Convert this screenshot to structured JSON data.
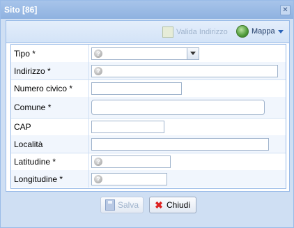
{
  "window": {
    "title": "Sito [86]"
  },
  "toolbar": {
    "valida_label": "Valida Indirizzo",
    "mappa_label": "Mappa"
  },
  "fields": [
    {
      "label": "Tipo *",
      "value": "",
      "kind": "combo"
    },
    {
      "label": "Indirizzo *",
      "value": "",
      "kind": "text-help"
    },
    {
      "label": "Numero civico *",
      "value": "",
      "kind": "text"
    },
    {
      "label": "Comune *",
      "value": "",
      "kind": "text-round"
    },
    {
      "label": "CAP",
      "value": "",
      "kind": "text"
    },
    {
      "label": "Località",
      "value": "",
      "kind": "text"
    },
    {
      "label": "Latitudine *",
      "value": "",
      "kind": "text-help"
    },
    {
      "label": "Longitudine *",
      "value": "",
      "kind": "text-help"
    }
  ],
  "buttons": {
    "save_label": "Salva",
    "close_label": "Chiudi"
  },
  "colors": {
    "title_bar": "#99bbe8",
    "body_bg": "#cfdff3"
  }
}
